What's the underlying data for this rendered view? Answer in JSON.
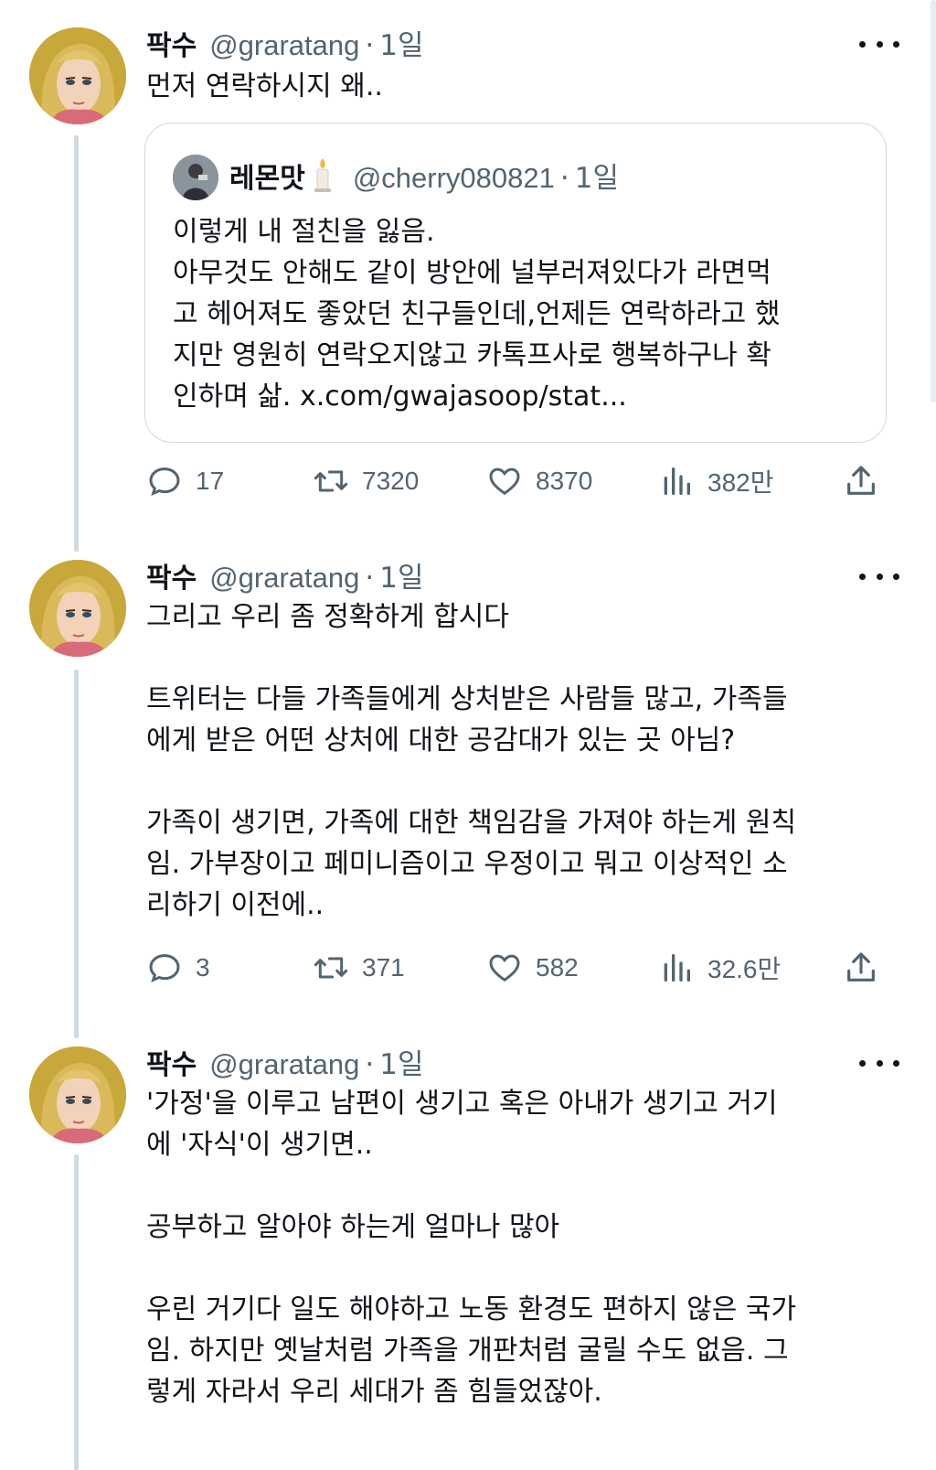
{
  "tweets": [
    {
      "author": {
        "name": "팍수",
        "handle": "@graratang",
        "time": "1일"
      },
      "text": "먼저 연락하시지 왜..",
      "quote": {
        "name": "레몬맛",
        "handle": "@cherry080821",
        "time": "1일",
        "text": "이렇게 내 절친을 잃음.\n아무것도 안해도 같이 방안에 널부러져있다가 라면먹\n고 헤어져도 좋았던 친구들인데,언제든 연락하라고 했\n지만 영원히 연락오지않고 카톡프사로 행복하구나 확\n인하며 삶. x.com/gwajasoop/stat..."
      },
      "stats": {
        "replies": "17",
        "retweets": "7320",
        "likes": "8370",
        "views": "382만"
      }
    },
    {
      "author": {
        "name": "팍수",
        "handle": "@graratang",
        "time": "1일"
      },
      "text": "그리고 우리 좀 정확하게 합시다\n\n트위터는 다들 가족들에게 상처받은 사람들 많고, 가족들\n에게 받은 어떤 상처에 대한 공감대가 있는 곳 아님?\n\n가족이 생기면, 가족에 대한 책임감을 가져야 하는게 원칙\n임. 가부장이고 페미니즘이고 우정이고 뭐고 이상적인 소\n리하기 이전에..",
      "stats": {
        "replies": "3",
        "retweets": "371",
        "likes": "582",
        "views": "32.6만"
      }
    },
    {
      "author": {
        "name": "팍수",
        "handle": "@graratang",
        "time": "1일"
      },
      "text": "'가정'을 이루고 남편이 생기고 혹은 아내가 생기고 거기\n에 '자식'이 생기면..\n\n공부하고 알아야 하는게 얼마나 많아\n\n우린 거기다 일도 해야하고 노동 환경도 편하지 않은 국가\n임. 하지만 옛날처럼 가족을 개판처럼 굴릴 수도 없음. 그\n렇게 자라서 우리 세대가 좀 힘들었잖아."
    }
  ],
  "colors": {
    "text": "#0f1419",
    "secondary": "#536471",
    "border": "#cfd9de"
  },
  "icons": [
    "reply-icon",
    "retweet-icon",
    "like-icon",
    "views-icon",
    "share-icon",
    "more-icon"
  ]
}
